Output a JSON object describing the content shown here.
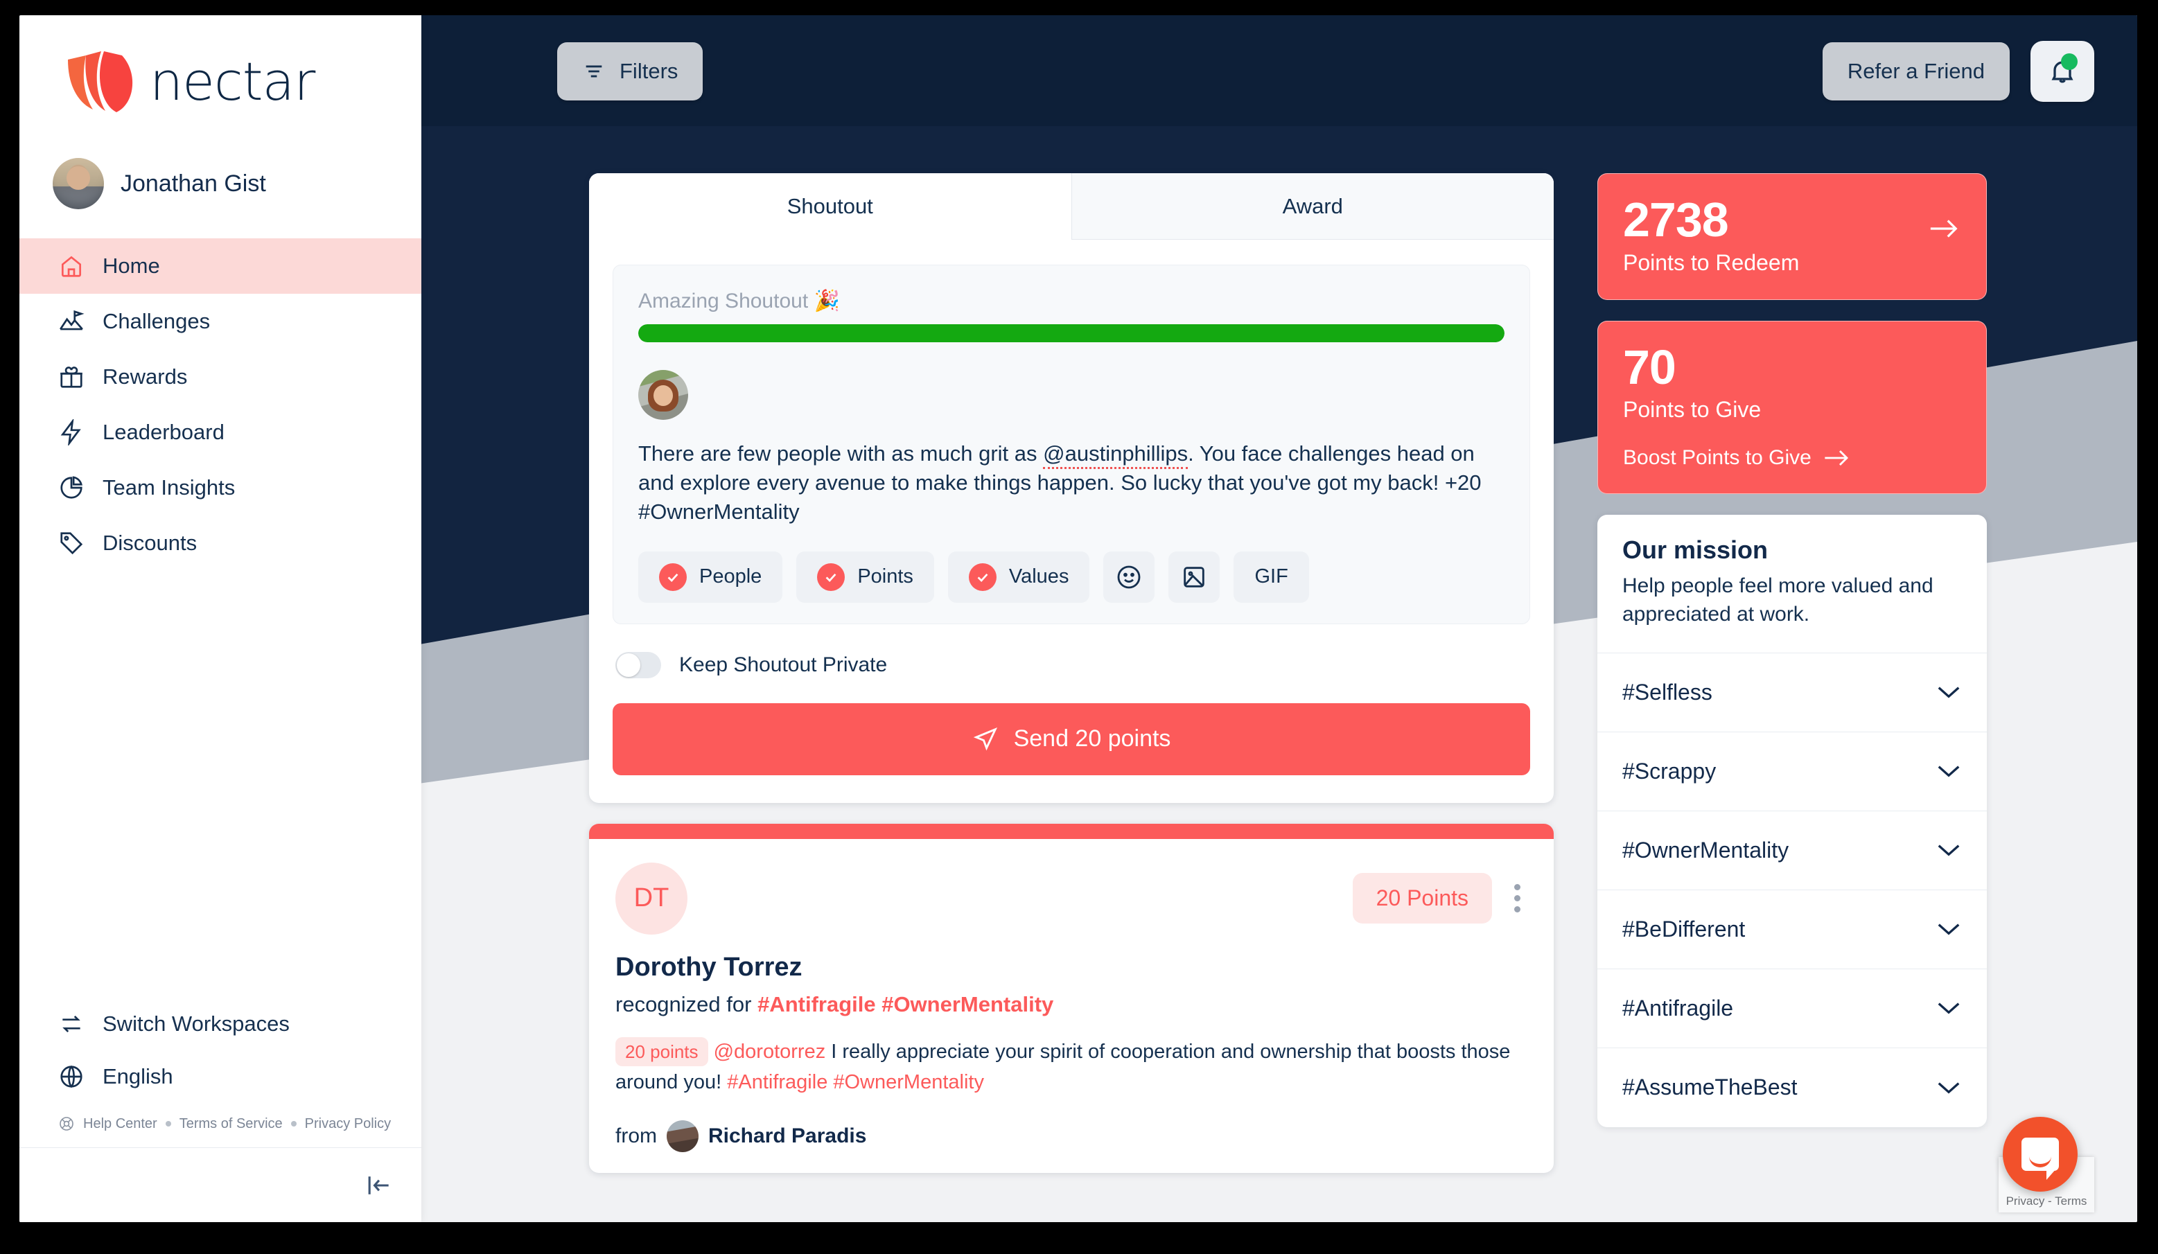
{
  "brand": {
    "name": "nectar",
    "accent": "#fc5a5a",
    "navy": "#12294a",
    "green": "#14a911"
  },
  "sidebar": {
    "user_name": "Jonathan Gist",
    "nav_items": [
      {
        "label": "Home",
        "icon": "home-icon",
        "active": true
      },
      {
        "label": "Challenges",
        "icon": "mountain-flag-icon",
        "active": false
      },
      {
        "label": "Rewards",
        "icon": "gift-icon",
        "active": false
      },
      {
        "label": "Leaderboard",
        "icon": "bolt-icon",
        "active": false
      },
      {
        "label": "Team Insights",
        "icon": "pie-chart-icon",
        "active": false
      },
      {
        "label": "Discounts",
        "icon": "tag-icon",
        "active": false
      }
    ],
    "footer_items": [
      {
        "label": "Switch Workspaces",
        "icon": "switch-icon"
      },
      {
        "label": "English",
        "icon": "globe-icon"
      }
    ],
    "legal": {
      "help_center": "Help Center",
      "terms": "Terms of Service",
      "privacy": "Privacy Policy"
    },
    "collapse_icon": "collapse-sidebar-icon"
  },
  "topbar": {
    "filters_label": "Filters",
    "refer_label": "Refer a Friend",
    "bell_icon": "bell-icon",
    "has_notification": true
  },
  "composer": {
    "tabs": [
      {
        "label": "Shoutout",
        "active": true
      },
      {
        "label": "Award",
        "active": false
      }
    ],
    "shoutout_title": "Amazing Shoutout 🎉",
    "progress_percent": 100,
    "message_pre": "There are few people with as much grit as ",
    "mention": "@austinphillips",
    "message_post": ". You face challenges head on and explore every avenue to make things happen. So lucky that you've got my back! +20 #OwnerMentality",
    "chips": [
      {
        "label": "People",
        "checked": true,
        "icon": "check-circle-icon"
      },
      {
        "label": "Points",
        "checked": true,
        "icon": "check-circle-icon"
      },
      {
        "label": "Values",
        "checked": true,
        "icon": "check-circle-icon"
      },
      {
        "label": "",
        "checked": false,
        "icon": "emoji-icon"
      },
      {
        "label": "",
        "checked": false,
        "icon": "image-icon"
      },
      {
        "label": "GIF",
        "checked": false,
        "icon": "gif-icon"
      }
    ],
    "privacy_label": "Keep Shoutout Private",
    "privacy_on": false,
    "send_label": "Send 20 points",
    "send_icon": "send-icon"
  },
  "post": {
    "initials": "DT",
    "points_badge": "20 Points",
    "recipient_name": "Dorothy Torrez",
    "recognized_prefix": "recognized for ",
    "recognized_tags": "#Antifragile #OwnerMentality",
    "points_pill": "20 points",
    "mention": "@dorotorrez",
    "body": " I really appreciate your spirit of cooperation and ownership that boosts those around you! ",
    "body_tags": "#Antifragile #OwnerMentality",
    "from_label": "from",
    "from_name": "Richard Paradis",
    "menu_icon": "kebab-menu-icon"
  },
  "rail": {
    "stats": [
      {
        "number": "2738",
        "label": "Points to Redeem",
        "link": "",
        "arrow": "arrow-right-icon"
      },
      {
        "number": "70",
        "label": "Points to Give",
        "link": "Boost Points to Give",
        "arrow": "arrow-right-icon"
      }
    ],
    "mission_title": "Our mission",
    "mission_text": "Help people feel more valued and appreciated at work.",
    "values": [
      "#Selfless",
      "#Scrappy",
      "#OwnerMentality",
      "#BeDifferent",
      "#Antifragile",
      "#AssumeTheBest"
    ],
    "chevron_icon": "chevron-down-icon"
  },
  "widgets": {
    "recaptcha_text": "Privacy - Terms",
    "chat_icon": "chat-bubble-icon"
  }
}
